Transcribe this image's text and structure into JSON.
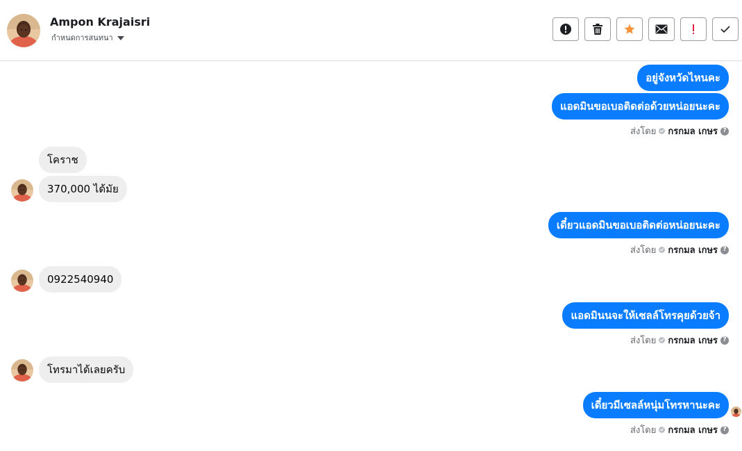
{
  "header": {
    "contact_name": "Ampon Krajaisri",
    "assign_label": "กำหนดการสนทนา",
    "toolbar": [
      {
        "icon": "alert-circle-icon",
        "name": "spam-button"
      },
      {
        "icon": "trash-icon",
        "name": "delete-button"
      },
      {
        "icon": "star-icon",
        "name": "star-button"
      },
      {
        "icon": "envelope-icon",
        "name": "mark-unread-button"
      },
      {
        "icon": "exclamation-icon",
        "name": "follow-up-button"
      },
      {
        "icon": "check-icon",
        "name": "mark-done-button"
      }
    ]
  },
  "colors": {
    "outgoing_bubble": "#0a7cff",
    "incoming_bubble": "#eeeeee",
    "star": "#f7923b",
    "exclamation": "#e41e3f"
  },
  "messages": [
    {
      "dir": "out",
      "text": "อยู่จังหวัดไหนคะ"
    },
    {
      "dir": "out",
      "text": "แอดมินขอเบอติดต่อด้วยหน่อยนะคะ"
    },
    {
      "dir": "meta",
      "sent_by_label": "ส่งโดย",
      "sender": "กรกมล เกษร"
    },
    {
      "dir": "in",
      "text": "โคราช"
    },
    {
      "dir": "in",
      "text": "370,000 ได้มัย"
    },
    {
      "dir": "out",
      "text": "เดี๋ยวแอดมินขอเบอติดต่อหน่อยนะคะ"
    },
    {
      "dir": "meta",
      "sent_by_label": "ส่งโดย",
      "sender": "กรกมล เกษร"
    },
    {
      "dir": "in",
      "text": "0922540940"
    },
    {
      "dir": "out",
      "text": "แอดมินนจะให้เซลล์โทรคุยด้วยจ้า"
    },
    {
      "dir": "meta",
      "sent_by_label": "ส่งโดย",
      "sender": "กรกมล เกษร"
    },
    {
      "dir": "in",
      "text": "โทรมาได้เลยครับ"
    },
    {
      "dir": "out",
      "text": "เดี๋ยวมีเซลล์หนุ่มโทรหานะคะ"
    },
    {
      "dir": "meta",
      "sent_by_label": "ส่งโดย",
      "sender": "กรกมล เกษร"
    }
  ]
}
